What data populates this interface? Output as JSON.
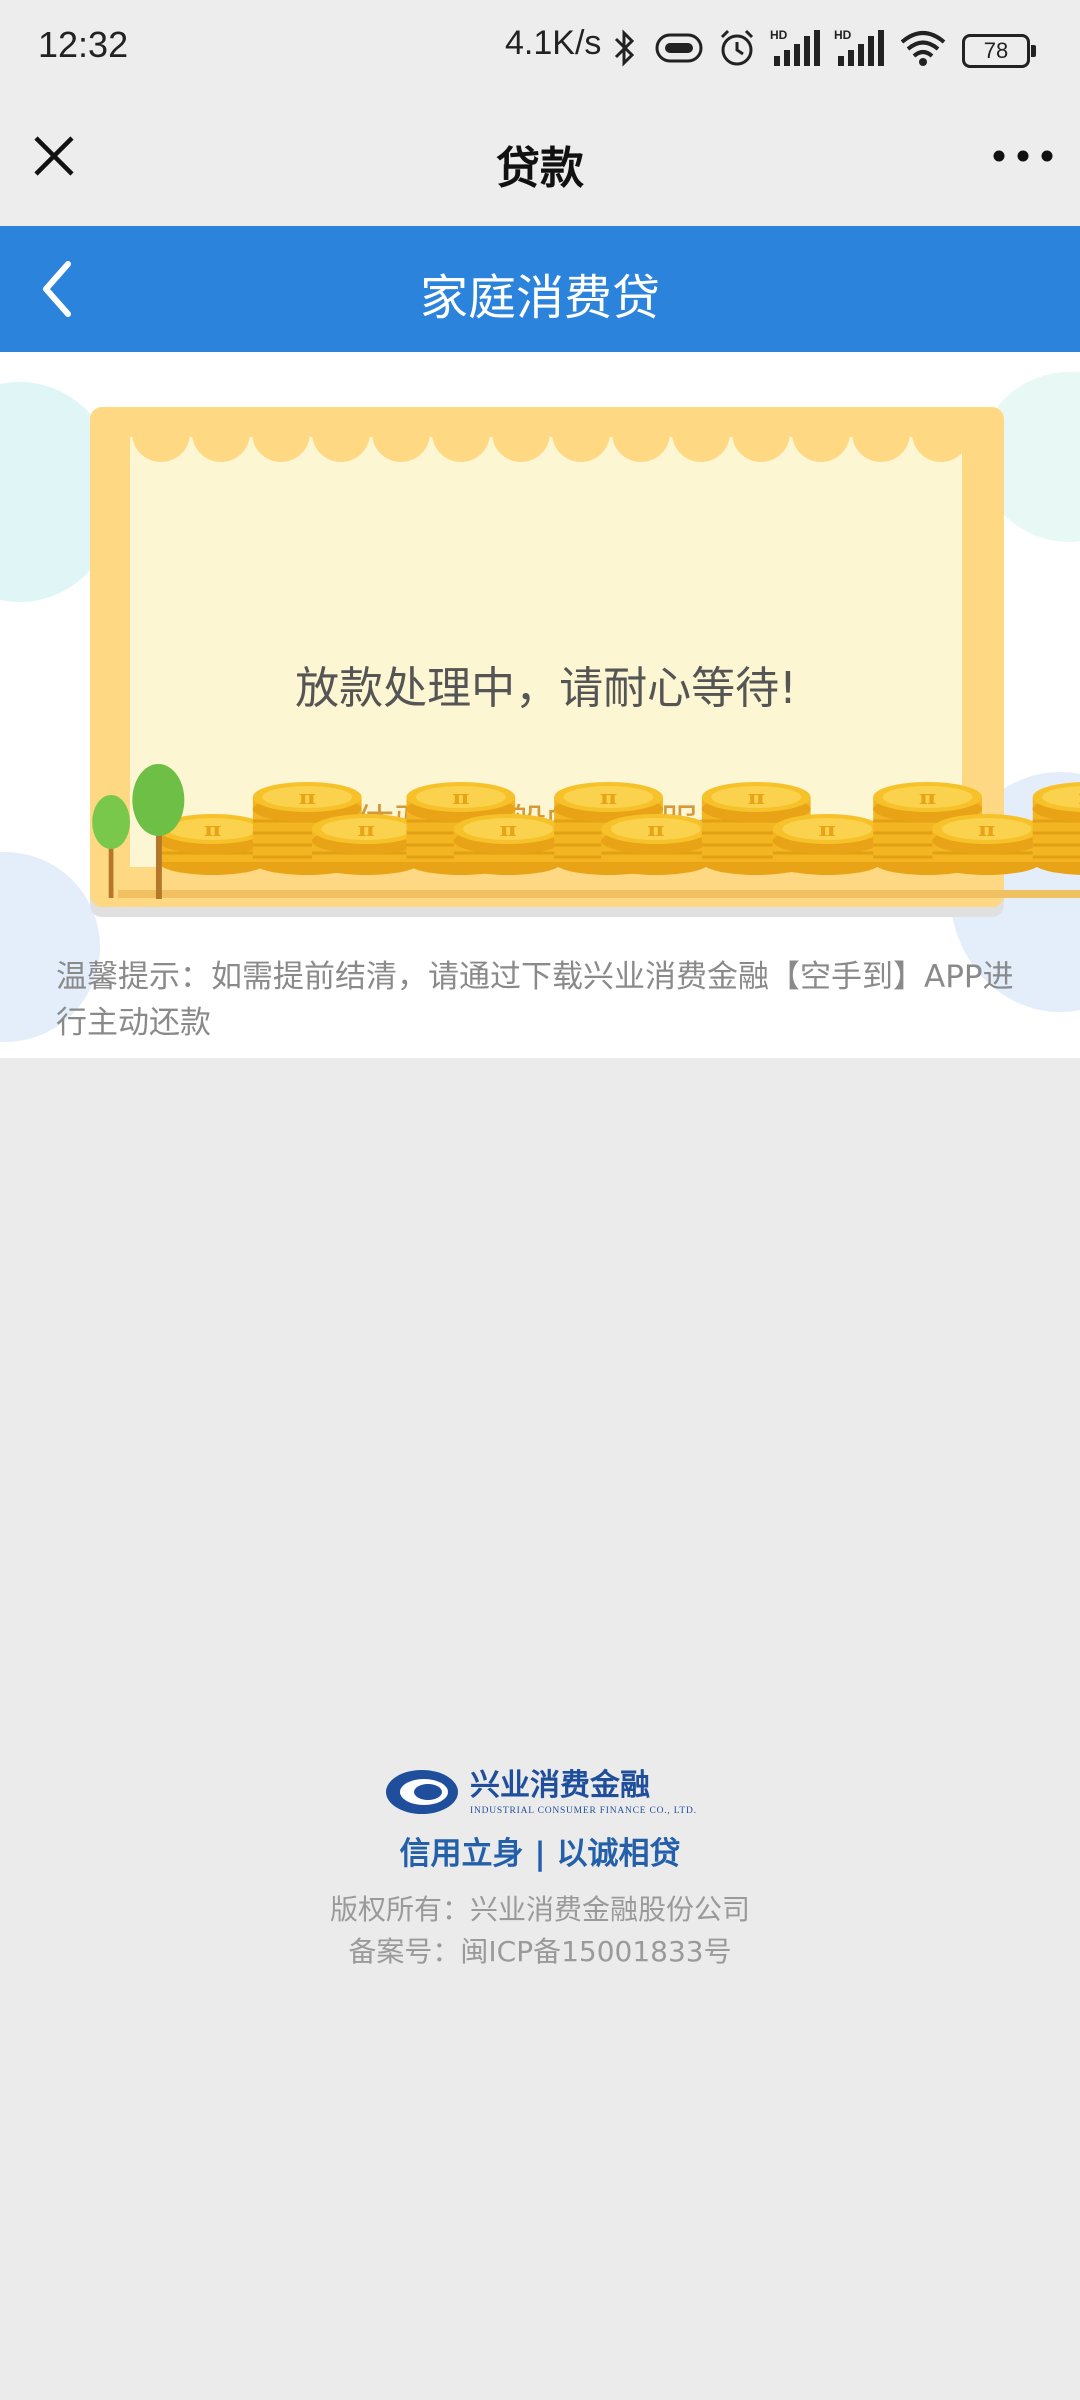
{
  "status": {
    "time": "12:32",
    "speed": "4.1K/s",
    "battery": "78"
  },
  "nav": {
    "title": "贷款"
  },
  "header": {
    "title": "家庭消费贷"
  },
  "card": {
    "message": "放款处理中，请耐心等待!",
    "subtitle": "体验飞一般的贷款服务"
  },
  "tip": "温馨提示：如需提前结清，请通过下载兴业消费金融【空手到】APP进行主动还款",
  "footer": {
    "logo_cn": "兴业消费金融",
    "logo_en": "INDUSTRIAL CONSUMER FINANCE CO., LTD.",
    "slogan": "信用立身 | 以诚相贷",
    "copyright": "版权所有：兴业消费金融股份公司",
    "icp": "备案号：闽ICP备15001833号"
  },
  "colors": {
    "brand_blue": "#2b83db",
    "card_yellow": "#ffd884",
    "coin": "#f7c12a"
  }
}
